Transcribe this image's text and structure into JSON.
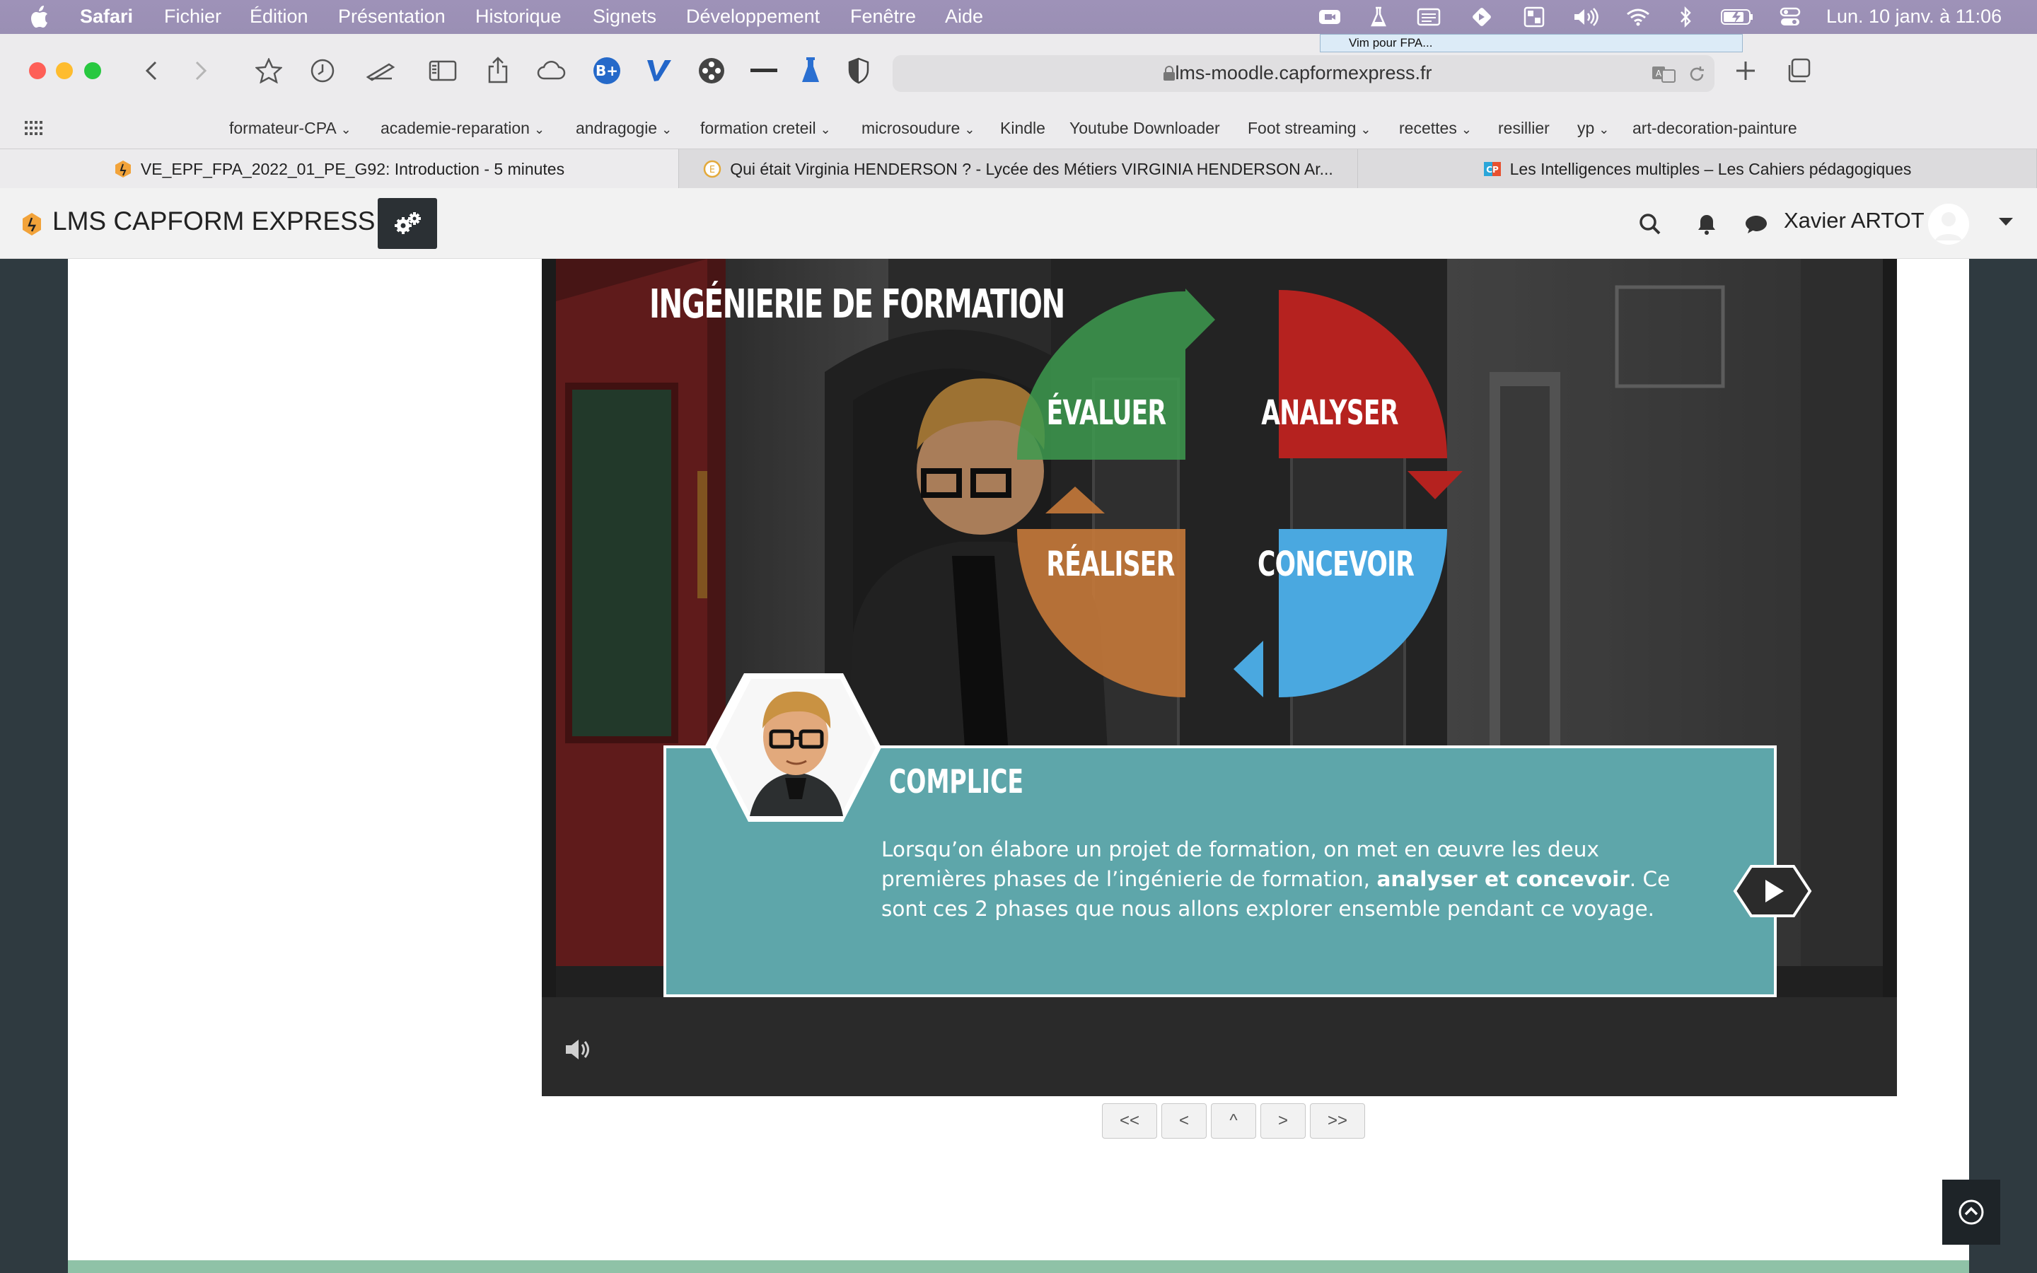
{
  "menubar": {
    "app": "Safari",
    "items": [
      "Fichier",
      "Édition",
      "Présentation",
      "Historique",
      "Signets",
      "Développement",
      "Fenêtre",
      "Aide"
    ],
    "clock": "Lun. 10 janv. à  11:06"
  },
  "tooltip": "Vim pour FPA...",
  "browser": {
    "url": "lms-moodle.capformexpress.fr",
    "bookmarks": [
      "formateur-CPA",
      "academie-reparation",
      "andragogie",
      "formation creteil",
      "microsoudure",
      "Kindle",
      "Youtube Downloader",
      "Foot streaming",
      "recettes",
      "resillier",
      "yp",
      "art-decoration-painture"
    ],
    "tabs": [
      "VE_EPF_FPA_2022_01_PE_G92: Introduction - 5 minutes",
      "Qui était Virginia HENDERSON ? - Lycée des Métiers VIRGINIA HENDERSON Ar...",
      "Les Intelligences multiples – Les Cahiers pédagogiques"
    ]
  },
  "site": {
    "name": "LMS CAPFORM EXPRESS",
    "user": "Xavier ARTOT"
  },
  "scene": {
    "title": "INGÉNIERIE DE FORMATION",
    "phases": {
      "evaluer": "ÉVALUER",
      "analyser": "ANALYSER",
      "realiser": "RÉALISER",
      "concevoir": "CONCEVOIR"
    },
    "speaker": "COMPLICE",
    "text_part1": "Lorsqu’on élabore un projet de formation, on met en œuvre les deux premières phases de l’ingénierie de formation, ",
    "text_bold": "analyser et concevoir",
    "text_part2": ". Ce sont ces 2 phases que nous allons explorer ensemble pendant ce voyage."
  },
  "pager": {
    "first": "<<",
    "prev": "<",
    "up": "^",
    "next": ">",
    "last": ">>"
  },
  "colors": {
    "evaluer": "#3d9a4f",
    "analyser": "#b5221f",
    "realiser": "#c2773a",
    "concevoir": "#4aa8e0",
    "dialog": "#5ea6aa"
  },
  "icons": [
    "apple-icon",
    "zoom-icon",
    "flask-icon",
    "calendar-icon",
    "diamond-icon",
    "grid-icon",
    "volume-icon",
    "wifi-icon",
    "bluetooth-icon",
    "battery-icon",
    "control-center-icon",
    "back-icon",
    "forward-icon",
    "star-icon",
    "history-icon",
    "reader-icon",
    "sidebar-icon",
    "share-icon",
    "icloud-icon",
    "extension-icons",
    "lock-icon",
    "translate-icon",
    "reload-icon",
    "new-tab-icon",
    "tabs-overview-icon",
    "search-icon",
    "bell-icon",
    "chat-icon",
    "gear-icon",
    "play-icon",
    "speaker-icon",
    "chevron-up-icon"
  ]
}
